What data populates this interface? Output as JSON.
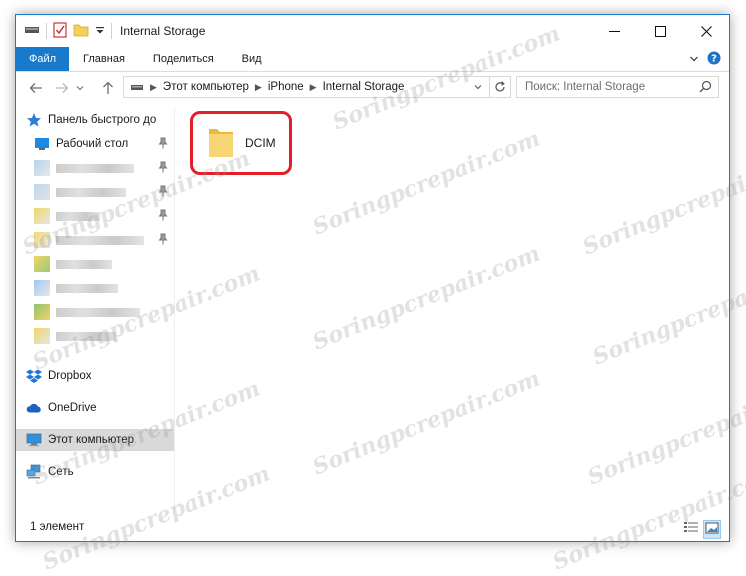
{
  "window": {
    "title": "Internal Storage",
    "accent": "#1979ca"
  },
  "ribbon": {
    "tabs": [
      {
        "label": "Файл"
      },
      {
        "label": "Главная"
      },
      {
        "label": "Поделиться"
      },
      {
        "label": "Вид"
      }
    ]
  },
  "address": {
    "crumbs": [
      "Этот компьютер",
      "iPhone",
      "Internal Storage"
    ]
  },
  "search": {
    "placeholder": "Поиск: Internal Storage"
  },
  "sidebar": {
    "items": [
      {
        "label": "Панель быстрого до",
        "icon": "star-icon"
      },
      {
        "label": "Рабочий стол",
        "icon": "desktop-icon"
      },
      {
        "label": "Dropbox",
        "icon": "dropbox-icon"
      },
      {
        "label": "OneDrive",
        "icon": "onedrive-icon"
      },
      {
        "label": "Этот компьютер",
        "icon": "computer-icon",
        "selected": true
      },
      {
        "label": "Сеть",
        "icon": "network-icon"
      }
    ]
  },
  "content": {
    "items": [
      {
        "label": "DCIM",
        "icon": "folder-icon",
        "highlight_color": "#e3202a"
      }
    ]
  },
  "status": {
    "count_text": "1 элемент"
  },
  "watermark": {
    "text": "Soringpcrepair.com"
  }
}
